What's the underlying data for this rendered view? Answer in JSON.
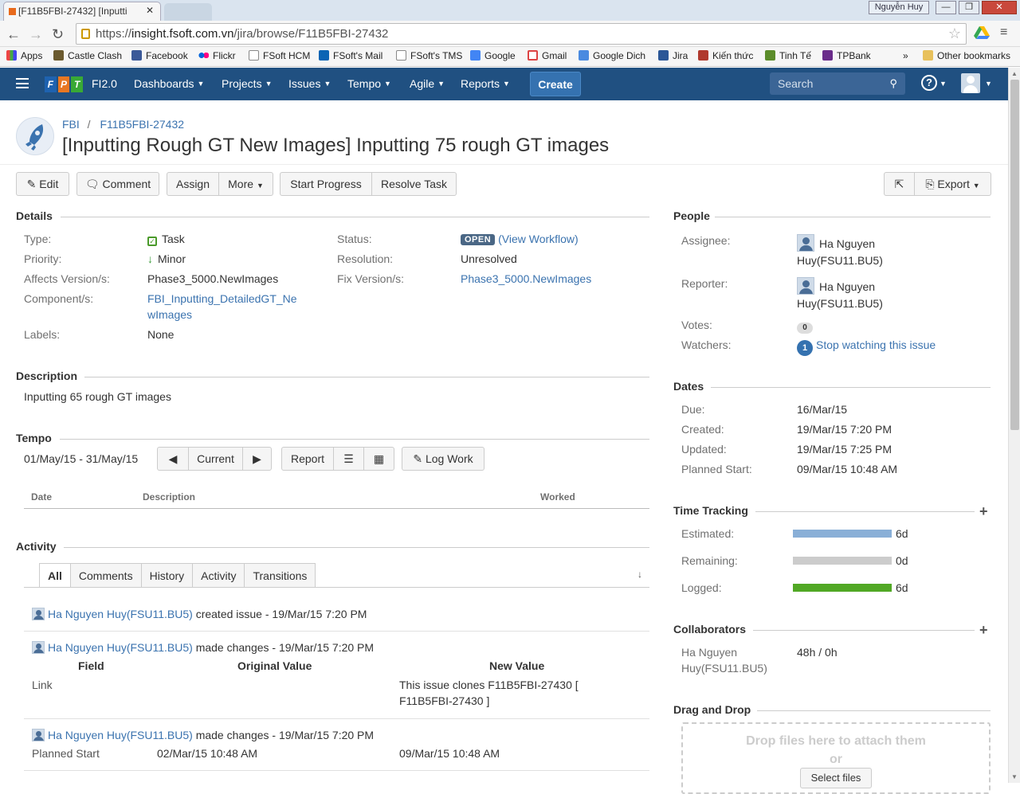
{
  "browser": {
    "tab_title": "[F11B5FBI-27432] [Inputti",
    "user_button": "Nguyễn Huy",
    "url_scheme": "https://",
    "url_host": "insight.fsoft.com.vn",
    "url_path": "/jira/browse/F11B5FBI-27432",
    "bookmarks": [
      "Apps",
      "Castle Clash",
      "Facebook",
      "Flickr",
      "FSoft HCM",
      "FSoft's Mail",
      "FSoft's TMS",
      "Google",
      "Gmail",
      "Google Dich",
      "Jira",
      "Kiến thức",
      "Tinh Tế",
      "TPBank"
    ],
    "other_bookmarks": "Other bookmarks",
    "more": "»"
  },
  "header": {
    "logo": [
      "F",
      "P",
      "T"
    ],
    "app_name": "FI2.0",
    "nav": [
      "Dashboards",
      "Projects",
      "Issues",
      "Tempo",
      "Agile",
      "Reports"
    ],
    "create_label": "Create",
    "search_placeholder": "Search",
    "help": "?"
  },
  "issue": {
    "project": "FBI",
    "key": "F11B5FBI-27432",
    "breadcrumb_sep": "/",
    "title": "[Inputting Rough GT New Images] Inputting 75 rough GT images"
  },
  "toolbar": {
    "edit": "Edit",
    "comment": "Comment",
    "assign": "Assign",
    "more": "More",
    "start_progress": "Start Progress",
    "resolve_task": "Resolve Task",
    "export": "Export"
  },
  "details": {
    "heading": "Details",
    "type_label": "Type:",
    "type": "Task",
    "priority_label": "Priority:",
    "priority": "Minor",
    "affects_label": "Affects Version/s:",
    "affects": "Phase3_5000.NewImages",
    "components_label": "Component/s:",
    "component_line1": "FBI_Inputting_DetailedGT_Ne",
    "component_line2": "wImages",
    "labels_label": "Labels:",
    "labels": "None",
    "status_label": "Status:",
    "status": "OPEN",
    "workflow_open": "(",
    "workflow_link": "View Workflow",
    "workflow_close": ")",
    "resolution_label": "Resolution:",
    "resolution": "Unresolved",
    "fix_label": "Fix Version/s:",
    "fix": "Phase3_5000.NewImages"
  },
  "description": {
    "heading": "Description",
    "text": "Inputting 65 rough GT images"
  },
  "tempo": {
    "heading": "Tempo",
    "range": "01/May/15 - 31/May/15",
    "current": "Current",
    "report": "Report",
    "log_work": "Log Work",
    "columns": [
      "Date",
      "Description",
      "Worked"
    ]
  },
  "activity": {
    "heading": "Activity",
    "tabs": [
      "All",
      "Comments",
      "History",
      "Activity",
      "Transitions"
    ],
    "entries": [
      {
        "user": "Ha Nguyen Huy(FSU11.BU5)",
        "action": " created issue - 19/Mar/15 7:20 PM"
      },
      {
        "user": "Ha Nguyen Huy(FSU11.BU5)",
        "action": " made changes - 19/Mar/15 7:20 PM"
      },
      {
        "user": "Ha Nguyen Huy(FSU11.BU5)",
        "action": " made changes - 19/Mar/15 7:20 PM"
      }
    ],
    "change_headers": [
      "Field",
      "Original Value",
      "New Value"
    ],
    "change1": {
      "field": "Link",
      "original": "",
      "new_line1": "This issue clones F11B5FBI-27430 [",
      "new_line2": "F11B5FBI-27430 ]"
    },
    "change2": {
      "field": "Planned Start",
      "original": "02/Mar/15 10:48 AM",
      "new": "09/Mar/15 10:48 AM"
    }
  },
  "people": {
    "heading": "People",
    "assignee_label": "Assignee:",
    "assignee_line1": "Ha Nguyen",
    "assignee_line2": "Huy(FSU11.BU5)",
    "reporter_label": "Reporter:",
    "reporter_line1": "Ha Nguyen",
    "reporter_line2": "Huy(FSU11.BU5)",
    "votes_label": "Votes:",
    "votes": "0",
    "watchers_label": "Watchers:",
    "watchers": "1",
    "stop_watching": "Stop watching this issue"
  },
  "dates": {
    "heading": "Dates",
    "due_label": "Due:",
    "due": "16/Mar/15",
    "created_label": "Created:",
    "created": "19/Mar/15 7:20 PM",
    "updated_label": "Updated:",
    "updated": "19/Mar/15 7:25 PM",
    "planned_label": "Planned Start:",
    "planned": "09/Mar/15 10:48 AM"
  },
  "time_tracking": {
    "heading": "Time Tracking",
    "estimated_label": "Estimated:",
    "estimated": "6d",
    "remaining_label": "Remaining:",
    "remaining": "0d",
    "logged_label": "Logged:",
    "logged": "6d",
    "colors": {
      "estimated": "#89afd7",
      "remaining": "#cccccc",
      "logged": "#51a825"
    }
  },
  "collaborators": {
    "heading": "Collaborators",
    "name_line1": "Ha Nguyen",
    "name_line2": "Huy(FSU11.BU5)",
    "hours": "48h / 0h"
  },
  "dragdrop": {
    "heading": "Drag and Drop",
    "drop_text": "Drop files here to attach them",
    "or": "or",
    "select": "Select files"
  }
}
